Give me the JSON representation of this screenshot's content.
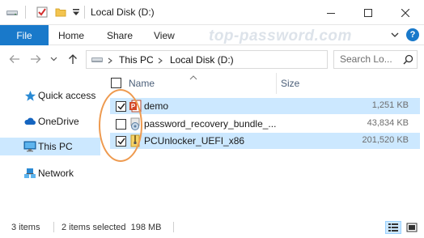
{
  "window": {
    "title": "Local Disk (D:)"
  },
  "ribbon": {
    "tabs": [
      "File",
      "Home",
      "Share",
      "View"
    ],
    "watermark": "top-password.com"
  },
  "address": {
    "segments": [
      "This PC",
      "Local Disk (D:)"
    ]
  },
  "search": {
    "placeholder": "Search Lo..."
  },
  "nav": {
    "items": [
      {
        "label": "Quick access",
        "icon": "star-icon"
      },
      {
        "label": "OneDrive",
        "icon": "cloud-icon"
      },
      {
        "label": "This PC",
        "icon": "computer-icon",
        "selected": true
      },
      {
        "label": "Network",
        "icon": "network-icon"
      }
    ]
  },
  "filelist": {
    "columns": {
      "name": "Name",
      "size": "Size"
    },
    "rows": [
      {
        "name": "demo",
        "size": "1,251 KB",
        "checked": true,
        "selected": true,
        "icon": "powerpoint-icon"
      },
      {
        "name": "password_recovery_bundle_...",
        "size": "43,834 KB",
        "checked": false,
        "selected": false,
        "icon": "installer-icon"
      },
      {
        "name": "PCUnlocker_UEFI_x86",
        "size": "201,520 KB",
        "checked": true,
        "selected": true,
        "icon": "zip-archive-icon"
      }
    ]
  },
  "statusbar": {
    "item_count": "3 items",
    "selection": "2 items selected  198 MB"
  },
  "colors": {
    "accent": "#1979ca",
    "selection": "#cce8ff",
    "annotation": "#ee9a4f"
  }
}
